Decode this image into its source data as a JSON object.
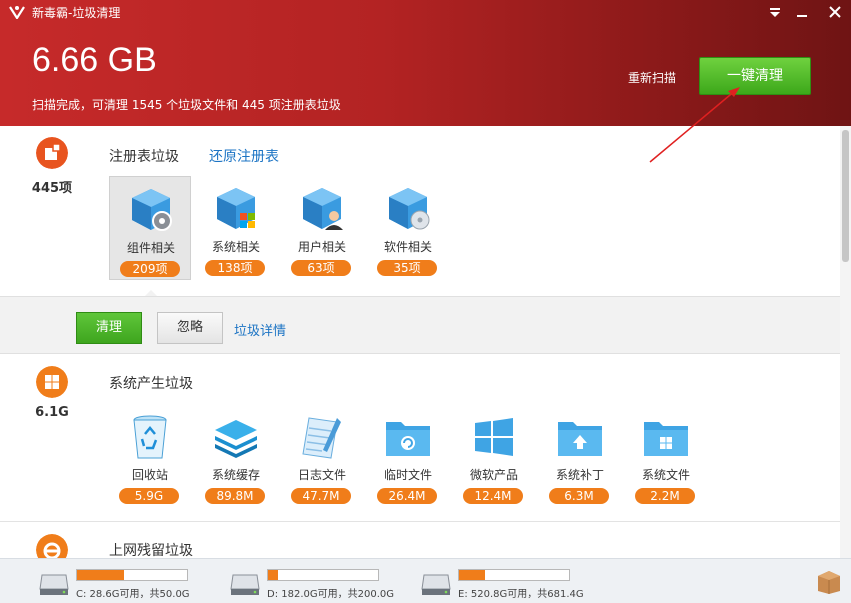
{
  "window": {
    "title": "新毒霸-垃圾清理"
  },
  "header": {
    "size": "6.66 GB",
    "summary": "扫描完成，可清理 1545 个垃圾文件和 445 项注册表垃圾",
    "rescan_label": "重新扫描",
    "oneclick_label": "一键清理"
  },
  "registry": {
    "count": "445项",
    "title": "注册表垃圾",
    "restore_label": "还原注册表",
    "items": [
      {
        "label": "组件相关",
        "count": "209项"
      },
      {
        "label": "系统相关",
        "count": "138项"
      },
      {
        "label": "用户相关",
        "count": "63项"
      },
      {
        "label": "软件相关",
        "count": "35项"
      }
    ],
    "actions": {
      "clean_label": "清理",
      "ignore_label": "忽略",
      "detail_label": "垃圾详情"
    }
  },
  "system": {
    "count": "6.1G",
    "title": "系统产生垃圾",
    "items": [
      {
        "label": "回收站",
        "count": "5.9G"
      },
      {
        "label": "系统缓存",
        "count": "89.8M"
      },
      {
        "label": "日志文件",
        "count": "47.7M"
      },
      {
        "label": "临时文件",
        "count": "26.4M"
      },
      {
        "label": "微软产品",
        "count": "12.4M"
      },
      {
        "label": "系统补丁",
        "count": "6.3M"
      },
      {
        "label": "系统文件",
        "count": "2.2M"
      }
    ]
  },
  "internet": {
    "title": "上网残留垃圾"
  },
  "drives": [
    {
      "text": "C: 28.6G可用，共50.0G",
      "used_fraction": 0.43
    },
    {
      "text": "D: 182.0G可用，共200.0G",
      "used_fraction": 0.09
    },
    {
      "text": "E: 520.8G可用，共681.4G",
      "used_fraction": 0.24
    }
  ],
  "colors": {
    "header_red": "#c62a2a",
    "accent_green": "#3da81a",
    "badge_orange": "#f07d1a",
    "link_blue": "#1c74c4"
  }
}
